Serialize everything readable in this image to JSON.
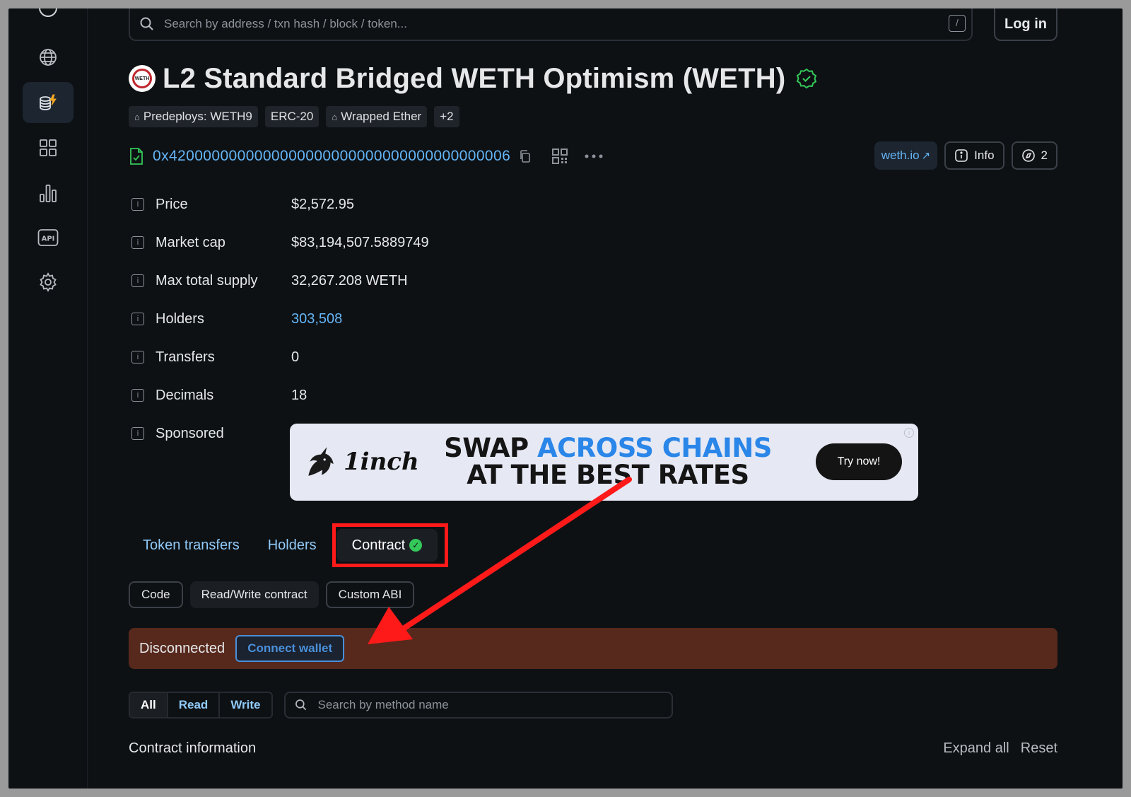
{
  "search": {
    "placeholder": "Search by address / txn hash / block / token...",
    "shortcut": "/"
  },
  "header": {
    "login_label": "Log in"
  },
  "sidebar": {
    "items": [
      {
        "icon": "globe-icon"
      },
      {
        "icon": "tokens-icon",
        "active": true
      },
      {
        "icon": "apps-grid-icon"
      },
      {
        "icon": "stats-icon"
      },
      {
        "icon": "api-icon"
      },
      {
        "icon": "gear-icon"
      }
    ]
  },
  "token": {
    "logo_text": "WETH",
    "title": "L2 Standard Bridged WETH Optimism (WETH)",
    "tags": [
      "Predeploys: WETH9",
      "ERC-20",
      "Wrapped Ether",
      "+2"
    ],
    "address": "0x4200000000000000000000000000000000000006",
    "website": "weth.io",
    "info_label": "Info",
    "apps_count": "2"
  },
  "details": [
    {
      "label": "Price",
      "value": "$2,572.95"
    },
    {
      "label": "Market cap",
      "value": "$83,194,507.5889749"
    },
    {
      "label": "Max total supply",
      "value": "32,267.208 WETH"
    },
    {
      "label": "Holders",
      "value": "303,508"
    },
    {
      "label": "Transfers",
      "value": "0"
    },
    {
      "label": "Decimals",
      "value": "18"
    },
    {
      "label": "Sponsored",
      "value": ""
    }
  ],
  "ad": {
    "brand": "1inch",
    "headline_1a": "SWAP ",
    "headline_1b": "ACROSS CHAINS",
    "headline_2": "AT THE BEST RATES",
    "cta": "Try now!",
    "info": "i"
  },
  "tabs": [
    "Token transfers",
    "Holders",
    "Contract"
  ],
  "subtabs": [
    "Code",
    "Read/Write contract",
    "Custom ABI"
  ],
  "wallet": {
    "status": "Disconnected",
    "connect_label": "Connect wallet"
  },
  "filters": {
    "segments": [
      "All",
      "Read",
      "Write"
    ],
    "method_placeholder": "Search by method name"
  },
  "contract_info": {
    "title": "Contract information",
    "expand_label": "Expand all",
    "reset_label": "Reset"
  },
  "colors": {
    "accent": "#64b5f6",
    "highlight": "#ff1a1a",
    "alert_bg": "#57291d",
    "verified": "#34c759"
  }
}
